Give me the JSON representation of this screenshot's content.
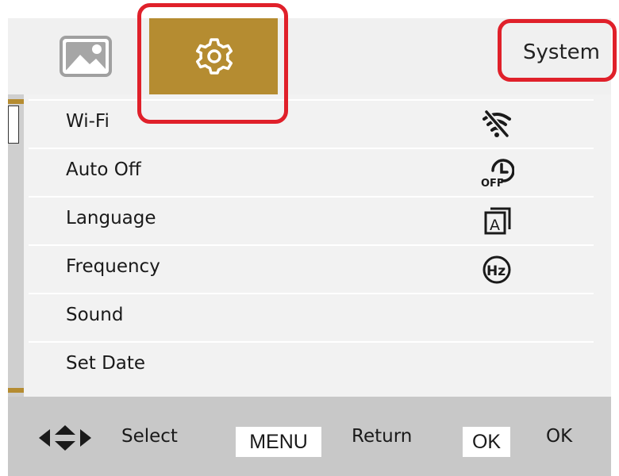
{
  "header": {
    "tabs": [
      {
        "name": "image",
        "icon": "image-icon",
        "active": false
      },
      {
        "name": "settings",
        "icon": "gear-icon",
        "active": true
      }
    ],
    "section_title": "System"
  },
  "menu": {
    "items": [
      {
        "label": "Wi-Fi",
        "icon": "wifi-off-icon"
      },
      {
        "label": "Auto Off",
        "icon": "auto-off-timer-icon"
      },
      {
        "label": "Language",
        "icon": "language-icon"
      },
      {
        "label": "Frequency",
        "icon": "frequency-hz-icon"
      },
      {
        "label": "Sound",
        "icon": ""
      },
      {
        "label": "Set Date",
        "icon": ""
      }
    ]
  },
  "footer": {
    "select_icon": "navigation-arrows-icon",
    "select_label": "Select",
    "menu_key": "MENU",
    "return_label": "Return",
    "ok_key": "OK",
    "ok_label": "OK"
  },
  "colors": {
    "accent": "#b58c31",
    "highlight": "#e0202a",
    "footer_bg": "#c8c8c8"
  }
}
